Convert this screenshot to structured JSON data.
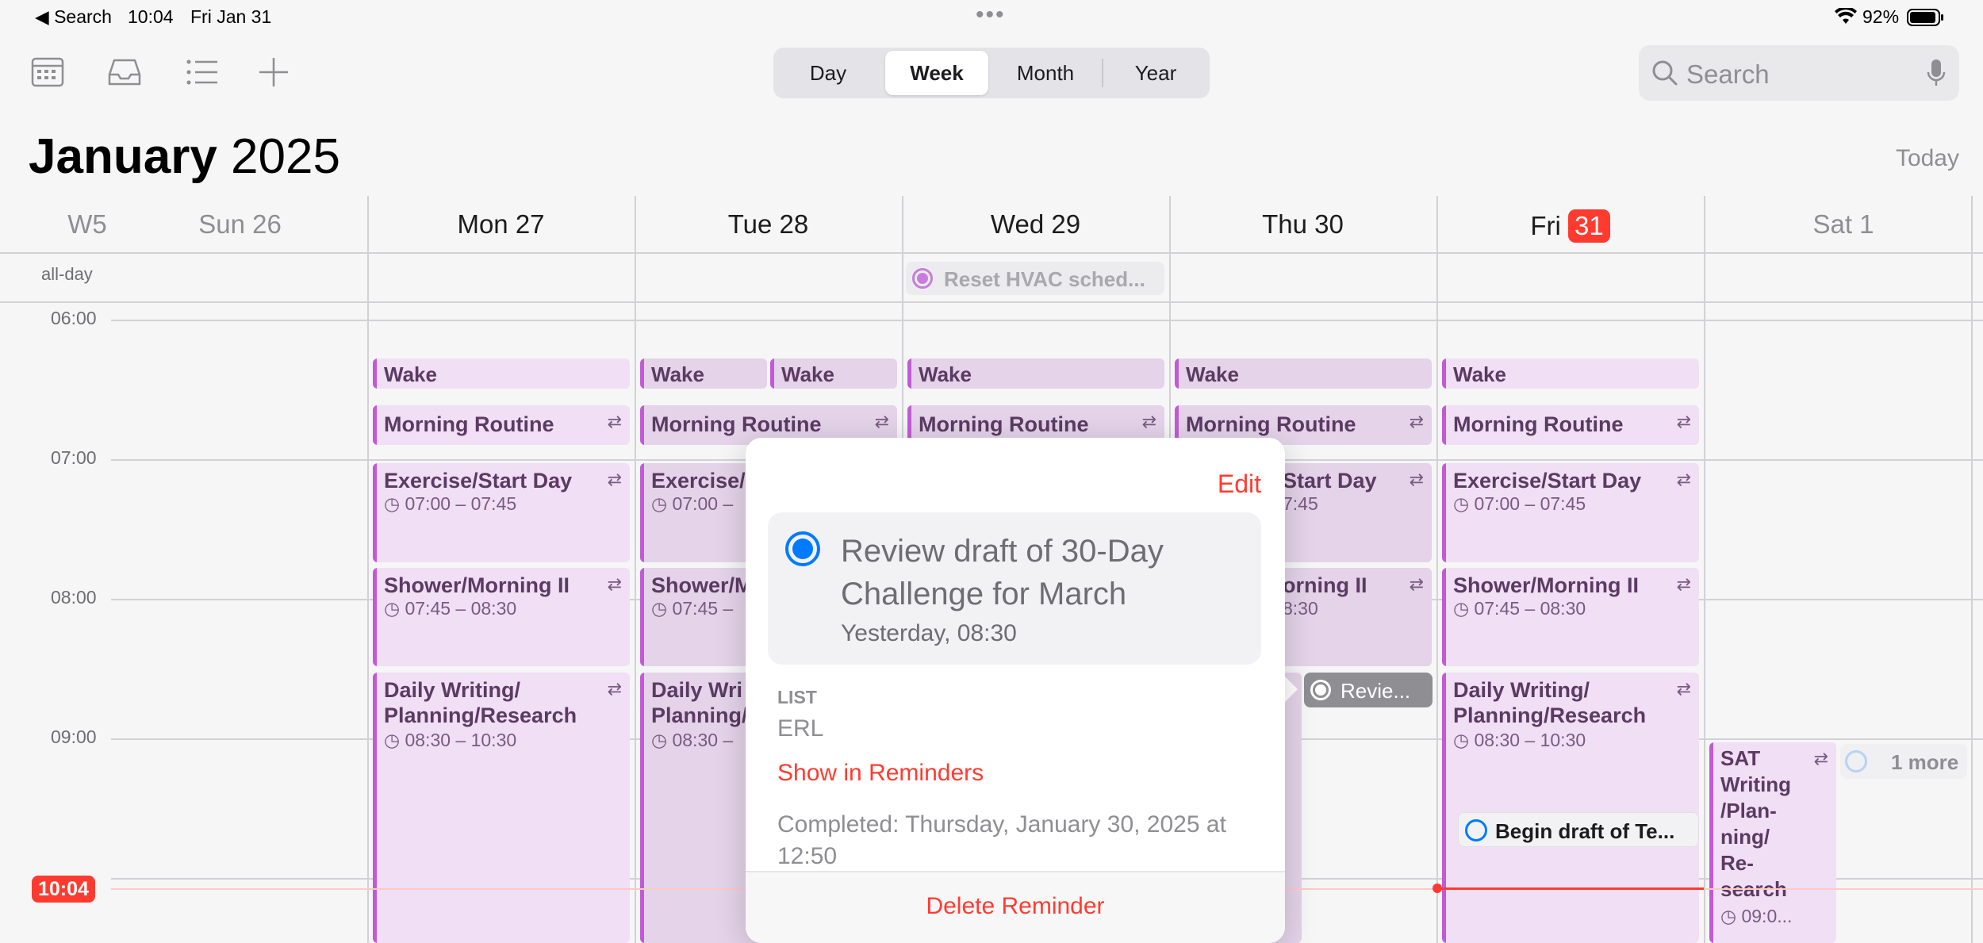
{
  "status_bar": {
    "back_label": "◀ Search",
    "time": "10:04",
    "date": "Fri Jan 31",
    "battery": "92%"
  },
  "toolbar": {
    "segments": [
      "Day",
      "Week",
      "Month",
      "Year"
    ],
    "active_segment": "Week",
    "search_placeholder": "Search"
  },
  "header": {
    "month": "January",
    "year": "2025",
    "today_label": "Today"
  },
  "week": {
    "week_label": "W5",
    "days": [
      "Sun 26",
      "Mon 27",
      "Tue 28",
      "Wed 29",
      "Thu 30",
      "Fri",
      "Sat 1"
    ],
    "today_day_number": "31",
    "all_day_label": "all-day",
    "times": [
      "06:00",
      "07:00",
      "08:00",
      "09:00"
    ],
    "current_time": "10:04"
  },
  "all_day_events": {
    "wed_reminder": "Reset HVAC sched..."
  },
  "events": {
    "wake": "Wake",
    "morning_routine": "Morning Routine",
    "exercise": "Exercise/Start Day",
    "exercise_time": "07:00 – 07:45",
    "exercise_partial": "Exercise/",
    "exercise_time_partial": "07:00 –",
    "exercise_thu_partial": "Start Day",
    "exercise_thu_time_partial": "7:45",
    "shower": "Shower/Morning II",
    "shower_time": "07:45 – 08:30",
    "shower_partial": "Shower/M",
    "shower_time_partial": "07:45 –",
    "shower_thu_partial": "orning II",
    "shower_thu_time_partial": "8:30",
    "writing_line1": "Daily Writing/",
    "writing_line2": "Planning/Research",
    "writing_time": "08:30 – 10:30",
    "writing_partial_line1": "Daily Wri",
    "writing_partial_line2": "Planning/",
    "writing_time_partial": "08:30 –",
    "thu_reminder": "Revie...",
    "fri_reminder": "Begin draft of Te...",
    "sat_event_lines": [
      "SAT",
      "Writing",
      "/Plan-",
      "ning/",
      "Re-",
      "search"
    ],
    "sat_event_time": "09:0...",
    "more_label": "1 more",
    "repeat_glyph": "⇄",
    "clock_glyph": "◷"
  },
  "popover": {
    "edit_label": "Edit",
    "reminder_title_line1": "Review draft of 30-Day",
    "reminder_title_line2": "Challenge for March",
    "reminder_due": "Yesterday, 08:30",
    "list_heading": "LIST",
    "list_name": "ERL",
    "show_link": "Show in Reminders",
    "completed_line1": "Completed: Thursday, January 30, 2025 at",
    "completed_line2": "12:50",
    "delete_label": "Delete Reminder"
  },
  "colors": {
    "accent_red": "#ff3b30",
    "event_fill": "#f0dff5",
    "event_bar": "#c25ad6",
    "reminder_blue": "#007aff"
  }
}
